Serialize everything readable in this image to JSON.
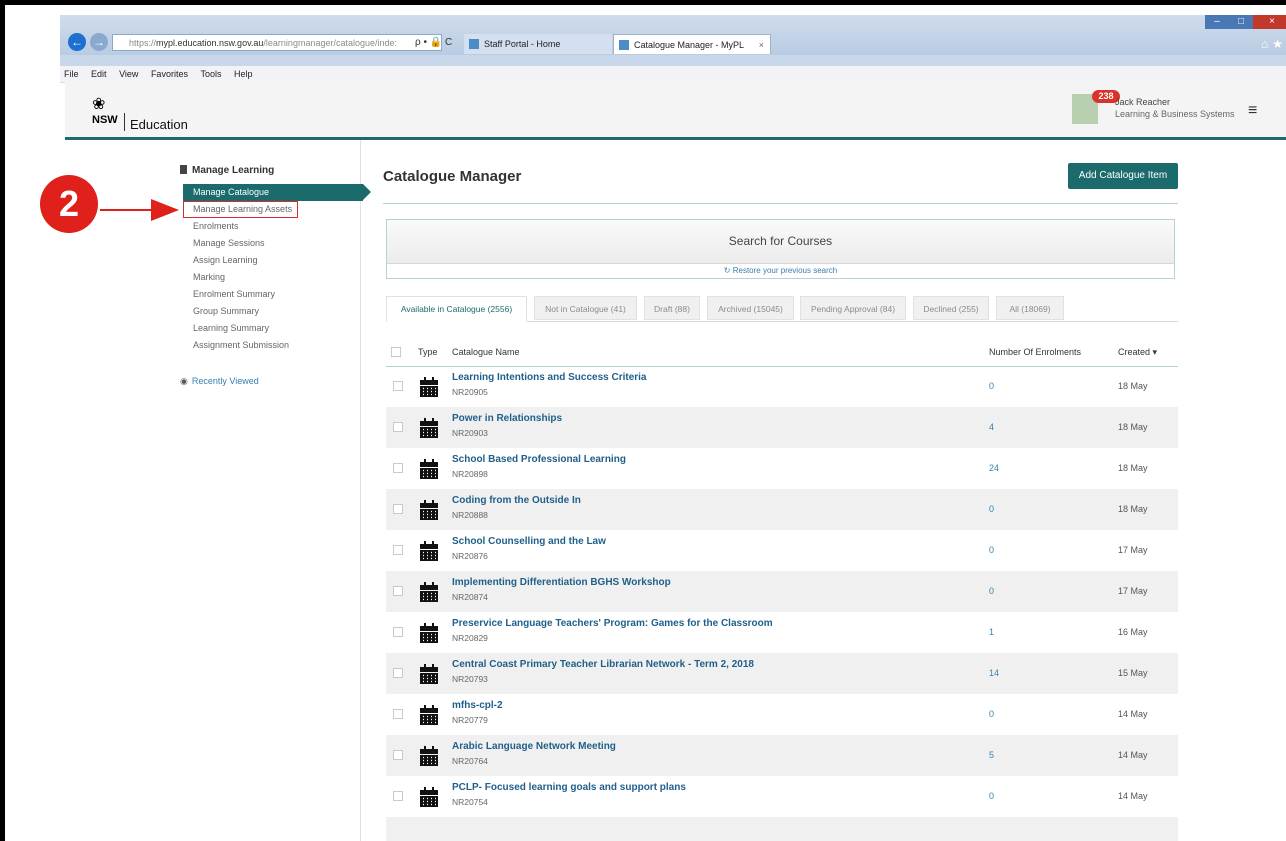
{
  "browser": {
    "url_prefix": "https://",
    "url_host": "mypl.education.nsw.gov.au",
    "url_path": "/learningmanager/catalogue/inde:",
    "addr_tools": "ρ • 🔒 C",
    "tabs": [
      {
        "label": "Staff Portal - Home"
      },
      {
        "label": "Catalogue Manager - MyPL"
      }
    ],
    "tab_close": "×",
    "menu": [
      "File",
      "Edit",
      "View",
      "Favorites",
      "Tools",
      "Help"
    ]
  },
  "header": {
    "logo_nsw": "NSW",
    "logo_dept": "Education",
    "notification_count": "238",
    "user_name": "Jack Reacher",
    "user_org": "Learning & Business Systems",
    "menu_icon": "≡"
  },
  "sidebar": {
    "section_title": "Manage Learning",
    "items": [
      {
        "label": "Manage Catalogue"
      },
      {
        "label": "Manage Learning Assets"
      },
      {
        "label": "Enrolments"
      },
      {
        "label": "Manage Sessions"
      },
      {
        "label": "Assign Learning"
      },
      {
        "label": "Marking"
      },
      {
        "label": "Enrolment Summary"
      },
      {
        "label": "Group Summary"
      },
      {
        "label": "Learning Summary"
      },
      {
        "label": "Assignment Submission"
      }
    ],
    "recently_viewed": "Recently Viewed"
  },
  "annotation": {
    "step": "2",
    "color": "#e0201b"
  },
  "main": {
    "title": "Catalogue Manager",
    "add_button": "Add Catalogue Item",
    "search_title": "Search for Courses",
    "restore_link": "Restore your previous search",
    "filter_tabs": [
      {
        "label": "Available in Catalogue (2556)"
      },
      {
        "label": "Not in Catalogue (41)"
      },
      {
        "label": "Draft (88)"
      },
      {
        "label": "Archived (15045)"
      },
      {
        "label": "Pending Approval (84)"
      },
      {
        "label": "Declined (255)"
      },
      {
        "label": "All (18069)"
      }
    ],
    "columns": {
      "type": "Type",
      "name": "Catalogue Name",
      "enrolments": "Number Of Enrolments",
      "created": "Created ▾"
    },
    "rows": [
      {
        "name": "Learning Intentions and Success Criteria",
        "code": "NR20905",
        "enrolments": "0",
        "created": "18 May"
      },
      {
        "name": "Power in Relationships",
        "code": "NR20903",
        "enrolments": "4",
        "created": "18 May"
      },
      {
        "name": "School Based Professional Learning",
        "code": "NR20898",
        "enrolments": "24",
        "created": "18 May"
      },
      {
        "name": "Coding from the Outside In",
        "code": "NR20888",
        "enrolments": "0",
        "created": "18 May"
      },
      {
        "name": "School Counselling and the Law",
        "code": "NR20876",
        "enrolments": "0",
        "created": "17 May"
      },
      {
        "name": "Implementing Differentiation BGHS Workshop",
        "code": "NR20874",
        "enrolments": "0",
        "created": "17 May"
      },
      {
        "name": "Preservice Language Teachers' Program: Games for the Classroom",
        "code": "NR20829",
        "enrolments": "1",
        "created": "16 May"
      },
      {
        "name": "Central Coast Primary Teacher Librarian Network - Term 2, 2018",
        "code": "NR20793",
        "enrolments": "14",
        "created": "15 May"
      },
      {
        "name": "mfhs-cpl-2",
        "code": "NR20779",
        "enrolments": "0",
        "created": "14 May"
      },
      {
        "name": "Arabic Language Network Meeting",
        "code": "NR20764",
        "enrolments": "5",
        "created": "14 May"
      },
      {
        "name": "PCLP- Focused learning goals and support plans",
        "code": "NR20754",
        "enrolments": "0",
        "created": "14 May"
      }
    ]
  },
  "colors": {
    "accent": "#1b6b6d",
    "link": "#1f5f8a",
    "badge": "#d9342b"
  }
}
